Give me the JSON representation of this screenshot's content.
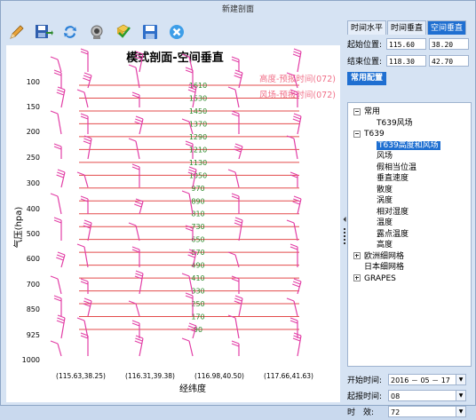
{
  "window": {
    "title": "新建剖面"
  },
  "toolbar": {
    "buttons": [
      "pencil-icon",
      "save-as-icon",
      "refresh-icon",
      "camera-icon",
      "approve-icon",
      "save-icon",
      "close-icon"
    ]
  },
  "chart": {
    "title": "模式剖面-空间垂直",
    "xlabel": "经纬度",
    "ylabel": "气压(hpa)",
    "legend": [
      "高度-预报时间(072)",
      "风场-预报时间(072)"
    ],
    "y_ticks": [
      "100",
      "150",
      "200",
      "250",
      "300",
      "400",
      "500",
      "600",
      "700",
      "850",
      "925",
      "1000"
    ],
    "x_ticks": [
      "(115.63,38.25)",
      "(116.31,39.38)",
      "(116.98,40.50)",
      "(117.66,41.63)"
    ],
    "colors": {
      "height_line": "#e34b4b",
      "height_label": "#2a8a2a",
      "wind": "#e23fa6",
      "legend_text": "#f07088"
    }
  },
  "chart_data": {
    "type": "line",
    "title": "模式剖面-空间垂直",
    "xlabel": "经纬度",
    "ylabel": "气压(hpa)",
    "series": [
      {
        "name": "高度-预报时间(072)",
        "contours": [
          1610,
          1530,
          1450,
          1370,
          1290,
          1210,
          1130,
          1050,
          970,
          890,
          810,
          730,
          650,
          570,
          490,
          410,
          330,
          250,
          170,
          90
        ]
      },
      {
        "name": "风场-预报时间(072)"
      }
    ]
  },
  "right": {
    "tabs": [
      "时间水平",
      "时间垂直",
      "空间垂直"
    ],
    "active_tab": 2,
    "start_label": "起始位置:",
    "start_lon": "115.60",
    "start_lat": "38.20",
    "end_label": "结束位置:",
    "end_lon": "118.30",
    "end_lat": "42.70",
    "config_header": "常用配置",
    "tree": [
      {
        "label": "常用",
        "level": 0,
        "exp": "minus"
      },
      {
        "label": "T639风场",
        "level": 1
      },
      {
        "label": "T639",
        "level": 0,
        "exp": "minus"
      },
      {
        "label": "T639高度和风场",
        "level": 1,
        "selected": true
      },
      {
        "label": "风场",
        "level": 1
      },
      {
        "label": "假相当位温",
        "level": 1
      },
      {
        "label": "垂直速度",
        "level": 1
      },
      {
        "label": "散度",
        "level": 1
      },
      {
        "label": "涡度",
        "level": 1
      },
      {
        "label": "相对湿度",
        "level": 1
      },
      {
        "label": "温度",
        "level": 1
      },
      {
        "label": "露点温度",
        "level": 1
      },
      {
        "label": "高度",
        "level": 1
      },
      {
        "label": "欧洲细网格",
        "level": 0,
        "exp": "plus"
      },
      {
        "label": "日本细网格",
        "level": 0,
        "exp": "none"
      },
      {
        "label": "GRAPES",
        "level": 0,
        "exp": "plus"
      }
    ],
    "start_time_label": "开始时间:",
    "start_time": "2016 － 05 － 17",
    "start_hour_label": "起报时间:",
    "start_hour": "08",
    "valid_label": "时　效:",
    "valid": "72"
  }
}
